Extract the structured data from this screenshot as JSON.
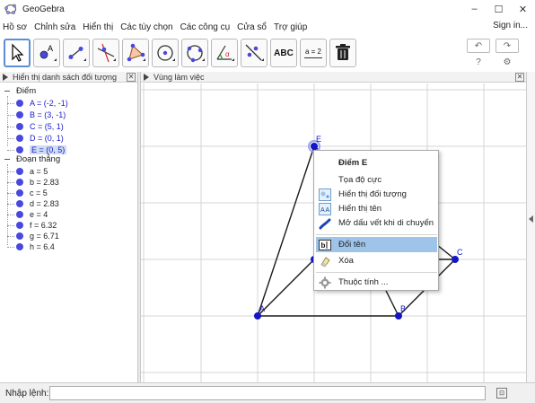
{
  "window": {
    "title": "GeoGebra",
    "minimize": "–",
    "maximize": "☐",
    "close": "✕"
  },
  "menu": {
    "items": [
      "Hồ sơ",
      "Chỉnh sửa",
      "Hiển thị",
      "Các tùy chọn",
      "Các công cụ",
      "Cửa sổ",
      "Trợ giúp"
    ],
    "signin": "Sign in..."
  },
  "toolbar": {
    "tools": [
      "move-tool",
      "point-tool",
      "line-tool",
      "perpendicular-tool",
      "polygon-tool",
      "circle-tool",
      "circle-three-points-tool",
      "angle-tool",
      "reflect-tool",
      "text-tool",
      "slider-tool",
      "delete-tool"
    ],
    "text_tool_label": "ABC",
    "slider_tool_label": "a = 2",
    "undo": "↶",
    "redo": "↷",
    "help": "?",
    "settings": "⚙"
  },
  "algebra_view": {
    "title": "Hiển thị danh sách đối tượng",
    "points_group": "Điểm",
    "points": [
      "A = (-2, -1)",
      "B = (3, -1)",
      "C = (5, 1)",
      "D = (0, 1)",
      "E = (0, 5)"
    ],
    "selected_point": "E = (0, 5)",
    "segments_group": "Đoạn thẳng",
    "segments": [
      "a = 5",
      "b = 2.83",
      "c = 5",
      "d = 2.83",
      "e = 4",
      "f = 6.32",
      "g = 6.71",
      "h = 6.4"
    ]
  },
  "graphics_view": {
    "title": "Vùng làm việc",
    "point_labels": {
      "A": "A",
      "B": "B",
      "C": "C",
      "E": "E"
    },
    "point_color": "#1414c8",
    "segment_color": "#1a1a1a"
  },
  "context_menu": {
    "title": "Điểm E",
    "items": [
      {
        "label": "Tọa độ cực",
        "icon": "none"
      },
      {
        "label": "Hiển thị đối tượng",
        "icon": "show-object-icon"
      },
      {
        "label": "Hiển thị tên",
        "icon": "show-label-icon"
      },
      {
        "label": "Mở dấu vết khi di chuyển",
        "icon": "trace-icon"
      },
      {
        "label": "Đổi tên",
        "icon": "rename-icon",
        "highlighted": true
      },
      {
        "label": "Xóa",
        "icon": "eraser-icon"
      },
      {
        "label": "Thuộc tính ...",
        "icon": "gear-icon"
      }
    ],
    "highlight_color": "#9ec4ea"
  },
  "input_bar": {
    "label": "Nhập lệnh:",
    "value": "",
    "placeholder": ""
  }
}
